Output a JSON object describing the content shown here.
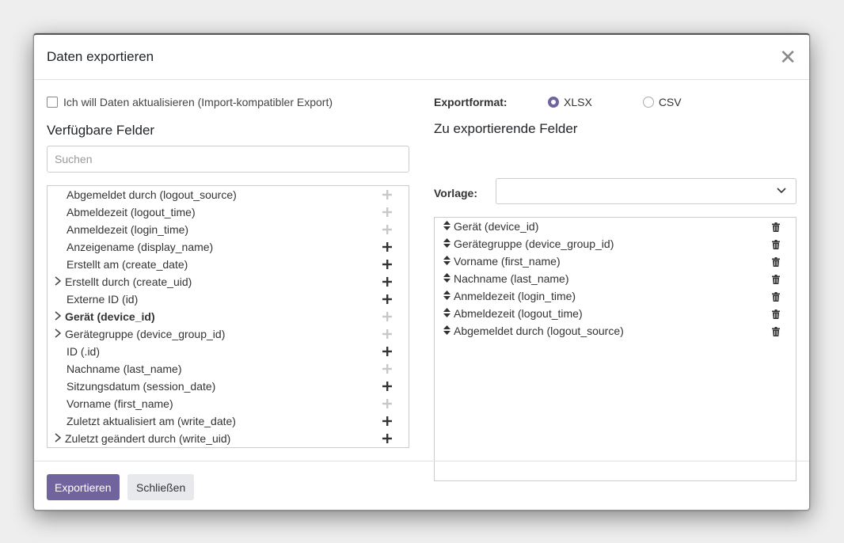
{
  "dialog": {
    "title": "Daten exportieren",
    "close_icon": "close-icon"
  },
  "left": {
    "import_compatible_label": "Ich will Daten aktualisieren (Import-kompatibler Export)",
    "available_title": "Verfügbare Felder",
    "search_placeholder": "Suchen",
    "fields": [
      {
        "label": "Abgemeldet durch (logout_source)",
        "expandable": false,
        "bold": false,
        "added": true
      },
      {
        "label": "Abmeldezeit (logout_time)",
        "expandable": false,
        "bold": false,
        "added": true
      },
      {
        "label": "Anmeldezeit (login_time)",
        "expandable": false,
        "bold": false,
        "added": true
      },
      {
        "label": "Anzeigename (display_name)",
        "expandable": false,
        "bold": false,
        "added": false
      },
      {
        "label": "Erstellt am (create_date)",
        "expandable": false,
        "bold": false,
        "added": false
      },
      {
        "label": "Erstellt durch (create_uid)",
        "expandable": true,
        "bold": false,
        "added": false
      },
      {
        "label": "Externe ID (id)",
        "expandable": false,
        "bold": false,
        "added": false
      },
      {
        "label": "Gerät (device_id)",
        "expandable": true,
        "bold": true,
        "added": true
      },
      {
        "label": "Gerätegruppe (device_group_id)",
        "expandable": true,
        "bold": false,
        "added": true
      },
      {
        "label": "ID (.id)",
        "expandable": false,
        "bold": false,
        "added": false
      },
      {
        "label": "Nachname (last_name)",
        "expandable": false,
        "bold": false,
        "added": true
      },
      {
        "label": "Sitzungsdatum (session_date)",
        "expandable": false,
        "bold": false,
        "added": false
      },
      {
        "label": "Vorname (first_name)",
        "expandable": false,
        "bold": false,
        "added": true
      },
      {
        "label": "Zuletzt aktualisiert am (write_date)",
        "expandable": false,
        "bold": false,
        "added": false
      },
      {
        "label": "Zuletzt geändert durch (write_uid)",
        "expandable": true,
        "bold": false,
        "added": false
      }
    ]
  },
  "right": {
    "format_label": "Exportformat:",
    "formats": [
      {
        "label": "XLSX",
        "selected": true
      },
      {
        "label": "CSV",
        "selected": false
      }
    ],
    "export_title": "Zu exportierende Felder",
    "template_label": "Vorlage:",
    "template_value": "",
    "export_fields": [
      "Gerät (device_id)",
      "Gerätegruppe (device_group_id)",
      "Vorname (first_name)",
      "Nachname (last_name)",
      "Anmeldezeit (login_time)",
      "Abmeldezeit (logout_time)",
      "Abgemeldet durch (logout_source)"
    ]
  },
  "footer": {
    "export_button": "Exportieren",
    "close_button": "Schließen"
  },
  "colors": {
    "primary": "#71639e",
    "secondary_btn": "#e7e9ed"
  }
}
